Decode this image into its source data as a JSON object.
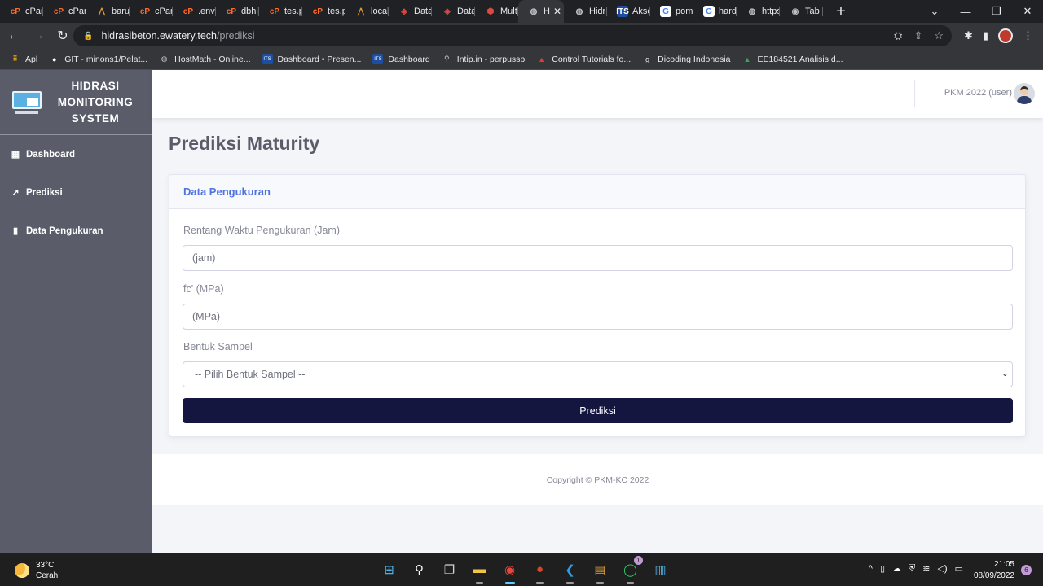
{
  "browser": {
    "tabs": [
      {
        "label": "cPan",
        "icon": "cpanel-icon",
        "glyph": "cP"
      },
      {
        "label": "cPan",
        "icon": "cpanel-icon",
        "glyph": "cP"
      },
      {
        "label": "baru",
        "icon": "xampp-icon",
        "glyph": "⋀"
      },
      {
        "label": "cPan",
        "icon": "cpanel-icon",
        "glyph": "cP"
      },
      {
        "label": ".env",
        "icon": "cpanel-icon",
        "glyph": "cP"
      },
      {
        "label": "dbhi",
        "icon": "cpanel-icon",
        "glyph": "cP"
      },
      {
        "label": "tes.p",
        "icon": "cpanel-icon",
        "glyph": "cP"
      },
      {
        "label": "tes.p",
        "icon": "cpanel-icon",
        "glyph": "cP"
      },
      {
        "label": "local",
        "icon": "xampp-icon",
        "glyph": "⋀"
      },
      {
        "label": "Data",
        "icon": "laravel-icon",
        "glyph": "◈"
      },
      {
        "label": "Data",
        "icon": "laravel-icon",
        "glyph": "◈"
      },
      {
        "label": "Mult",
        "icon": "cube-icon",
        "glyph": "⬢"
      },
      {
        "label": "H",
        "icon": "globe-icon",
        "glyph": "◍",
        "active": true
      },
      {
        "label": "Hidr",
        "icon": "globe-icon",
        "glyph": "◍"
      },
      {
        "label": "Akse",
        "icon": "its-icon",
        "glyph": "ITS"
      },
      {
        "label": "pom",
        "icon": "google-icon",
        "glyph": "G"
      },
      {
        "label": "hard",
        "icon": "google-icon",
        "glyph": "G"
      },
      {
        "label": "https",
        "icon": "globe-icon",
        "glyph": "◍"
      },
      {
        "label": "Tab E",
        "icon": "chrome-icon",
        "glyph": "◉"
      }
    ],
    "url_host": "hidrasibeton.ewatery.tech",
    "url_path": "/prediksi",
    "bookmarks": [
      {
        "label": "Apl",
        "icon": "apps-grid-icon",
        "glyph": "⠿"
      },
      {
        "label": "GIT - minons1/Pelat...",
        "icon": "github-icon",
        "glyph": "●"
      },
      {
        "label": "HostMath - Online...",
        "icon": "globe-icon",
        "glyph": "◍"
      },
      {
        "label": "Dashboard • Presen...",
        "icon": "its-icon",
        "glyph": "ITS"
      },
      {
        "label": "Dashboard",
        "icon": "its-icon",
        "glyph": "ITS"
      },
      {
        "label": "Intip.in - perpussp",
        "icon": "search-icon",
        "glyph": "⚲"
      },
      {
        "label": "Control Tutorials fo...",
        "icon": "ctms-icon",
        "glyph": "▲"
      },
      {
        "label": "Dicoding Indonesia",
        "icon": "dicoding-icon",
        "glyph": "g"
      },
      {
        "label": "EE184521 Analisis d...",
        "icon": "drive-icon",
        "glyph": "▲"
      }
    ]
  },
  "app": {
    "brand_lines": [
      "HIDRASI",
      "MONITORING",
      "SYSTEM"
    ],
    "sidebar": [
      {
        "label": "Dashboard",
        "icon": "table-icon",
        "glyph": "▦"
      },
      {
        "label": "Prediksi",
        "icon": "chart-line-icon",
        "glyph": "↗"
      },
      {
        "label": "Data Pengukuran",
        "icon": "file-icon",
        "glyph": "▮"
      }
    ],
    "user_name": "PKM 2022 (user)",
    "page_title": "Prediksi Maturity",
    "card_title": "Data Pengukuran",
    "form": {
      "time_label": "Rentang Waktu Pengukuran (Jam)",
      "time_placeholder": "(jam)",
      "fc_label": "fc' (MPa)",
      "fc_placeholder": "(MPa)",
      "shape_label": "Bentuk Sampel",
      "shape_selected": "-- Pilih Bentuk Sampel --",
      "submit_label": "Prediksi"
    },
    "footer": "Copyright © PKM-KC 2022"
  },
  "taskbar": {
    "weather_temp": "33°C",
    "weather_desc": "Cerah",
    "whatsapp_badge": "1",
    "time": "21:05",
    "date": "08/09/2022",
    "notifications": "6"
  },
  "colors": {
    "sidebar_bg": "#5a5c69",
    "primary": "#4e73df",
    "button_bg": "#151640"
  }
}
